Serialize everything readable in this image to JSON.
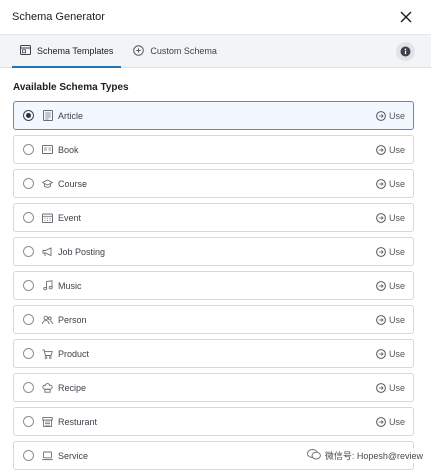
{
  "header": {
    "title": "Schema Generator"
  },
  "tabs": [
    {
      "label": "Schema Templates",
      "icon": "template-icon",
      "active": true
    },
    {
      "label": "Custom Schema",
      "icon": "plus-circle-icon",
      "active": false
    }
  ],
  "section": {
    "title": "Available Schema Types"
  },
  "use_label": "Use",
  "schema_types": [
    {
      "label": "Article",
      "icon": "article-icon",
      "selected": true
    },
    {
      "label": "Book",
      "icon": "book-icon",
      "selected": false
    },
    {
      "label": "Course",
      "icon": "graduation-cap-icon",
      "selected": false
    },
    {
      "label": "Event",
      "icon": "calendar-icon",
      "selected": false
    },
    {
      "label": "Job Posting",
      "icon": "megaphone-icon",
      "selected": false
    },
    {
      "label": "Music",
      "icon": "music-icon",
      "selected": false
    },
    {
      "label": "Person",
      "icon": "people-icon",
      "selected": false
    },
    {
      "label": "Product",
      "icon": "cart-icon",
      "selected": false
    },
    {
      "label": "Recipe",
      "icon": "chef-hat-icon",
      "selected": false
    },
    {
      "label": "Resturant",
      "icon": "store-icon",
      "selected": false
    },
    {
      "label": "Service",
      "icon": "laptop-icon",
      "selected": false
    }
  ],
  "watermark": {
    "text": "微信号: Hopesh@review"
  },
  "colors": {
    "accent": "#2271b1",
    "selected_border": "#4a90d9",
    "selected_bg": "#f2f8fd"
  }
}
